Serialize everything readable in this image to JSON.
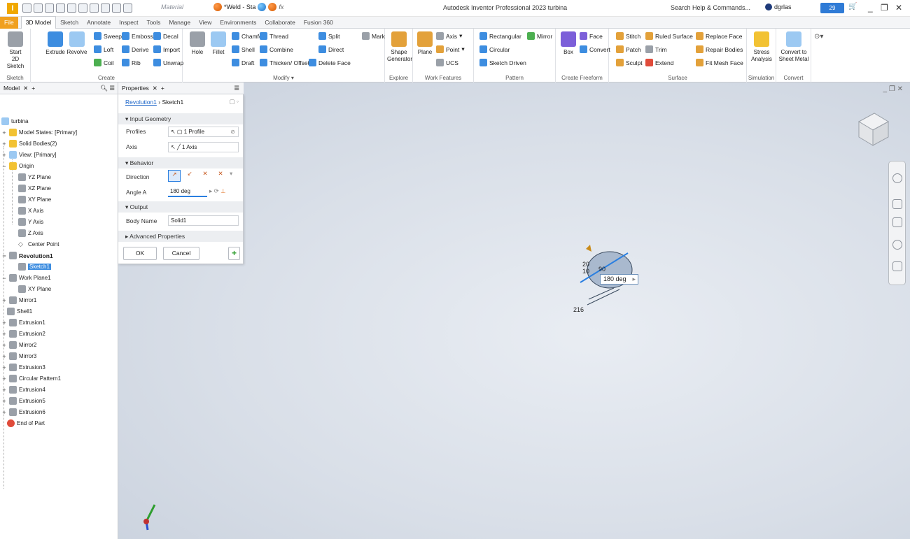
{
  "titlebar": {
    "material": "Material",
    "weld_doc": "*Weld - Sta",
    "app_title": "Autodesk Inventor Professional 2023   turbina",
    "search": "Search Help & Commands...",
    "user": "dgrlas",
    "clock": "29"
  },
  "menu": [
    "File",
    "3D Model",
    "Sketch",
    "Annotate",
    "Inspect",
    "Tools",
    "Manage",
    "View",
    "Environments",
    "Collaborate",
    "Fusion 360"
  ],
  "ribbon": {
    "sketch": {
      "start": "Start",
      "sketch2d": "2D Sketch",
      "title": "Sketch"
    },
    "create": {
      "extrude": "Extrude",
      "revolve": "Revolve",
      "sweep": "Sweep",
      "emboss": "Emboss",
      "decal": "Decal",
      "loft": "Loft",
      "derive": "Derive",
      "import": "Import",
      "coil": "Coil",
      "rib": "Rib",
      "unwrap": "Unwrap",
      "title": "Create"
    },
    "modify": {
      "hole": "Hole",
      "fillet": "Fillet",
      "chamfer": "Chamfer",
      "thread": "Thread",
      "split": "Split",
      "mark": "Mark",
      "shell": "Shell",
      "combine": "Combine",
      "direct": "Direct",
      "draft": "Draft",
      "thicken": "Thicken/ Offset",
      "delete_face": "Delete Face",
      "title": "Modify"
    },
    "explore": {
      "shape": "Shape",
      "generator": "Generator",
      "title": "Explore"
    },
    "workfeatures": {
      "plane": "Plane",
      "axis": "Axis",
      "point": "Point",
      "ucs": "UCS",
      "title": "Work Features"
    },
    "pattern": {
      "rect": "Rectangular",
      "mirror": "Mirror",
      "circular": "Circular",
      "sketch_driven": "Sketch Driven",
      "title": "Pattern"
    },
    "freeform": {
      "box": "Box",
      "face": "Face",
      "convert": "Convert",
      "title": "Create Freeform"
    },
    "surface": {
      "stitch": "Stitch",
      "ruled": "Ruled Surface",
      "replace": "Replace Face",
      "patch": "Patch",
      "trim": "Trim",
      "repair": "Repair Bodies",
      "sculpt": "Sculpt",
      "extend": "Extend",
      "fitmesh": "Fit Mesh Face",
      "title": "Surface"
    },
    "simulation": {
      "stress": "Stress",
      "analysis": "Analysis",
      "title": "Simulation"
    },
    "convert": {
      "to": "Convert to",
      "sheetmetal": "Sheet Metal",
      "title": "Convert"
    }
  },
  "browser": {
    "tab": "Model",
    "root": "turbina",
    "items": [
      "Model States: [Primary]",
      "Solid Bodies(2)",
      "View: [Primary]",
      "Origin",
      "YZ Plane",
      "XZ Plane",
      "XY Plane",
      "X Axis",
      "Y Axis",
      "Z Axis",
      "Center Point",
      "Revolution1",
      "Sketch1",
      "Work Plane1",
      "XY Plane",
      "Mirror1",
      "Shell1",
      "Extrusion1",
      "Extrusion2",
      "Mirror2",
      "Mirror3",
      "Extrusion3",
      "Circular Pattern1",
      "Extrusion4",
      "Extrusion5",
      "Extrusion6",
      "End of Part"
    ]
  },
  "properties": {
    "tab": "Properties",
    "breadcrumb_a": "Revolution1",
    "breadcrumb_b": "Sketch1",
    "input_geometry": "Input Geometry",
    "profiles_label": "Profiles",
    "profiles_value": "1 Profile",
    "axis_label": "Axis",
    "axis_value": "1 Axis",
    "behavior": "Behavior",
    "direction_label": "Direction",
    "angle_label": "Angle A",
    "angle_value": "180 deg",
    "output": "Output",
    "body_label": "Body Name",
    "body_value": "Solid1",
    "advanced": "Advanced Properties",
    "ok": "OK",
    "cancel": "Cancel"
  },
  "viewport": {
    "dim_tooltip": "180 deg",
    "dim_a": "20",
    "dim_b": "10",
    "dim_c": "90",
    "dim_d": "216"
  }
}
